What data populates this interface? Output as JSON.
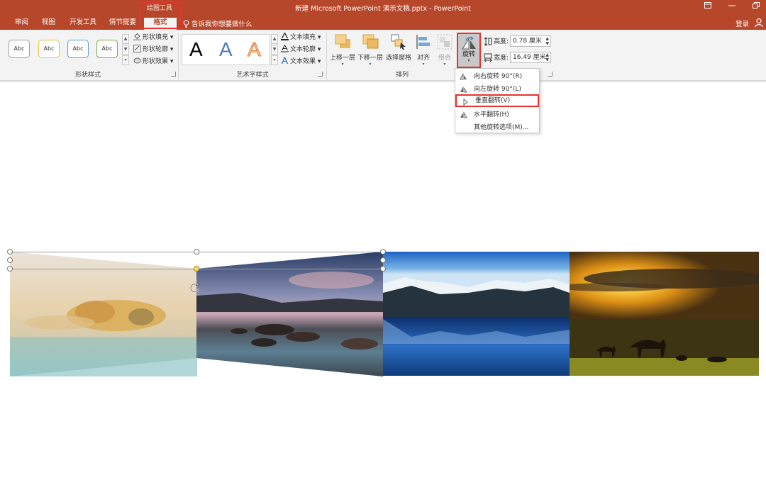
{
  "window": {
    "title": "新建 Microsoft PowerPoint 演示文稿.pptx - PowerPoint",
    "context_group": "绘图工具",
    "login": "登录"
  },
  "tabs": [
    "审阅",
    "视图",
    "开发工具",
    "情节提要",
    "格式"
  ],
  "tellme": "告诉我你想要做什么",
  "shape_styles": {
    "swatches": [
      "Abc",
      "Abc",
      "Abc",
      "Abc"
    ],
    "swatch_colors": [
      "#9e9e9e",
      "#e7c233",
      "#5b9bd5",
      "#70ad47"
    ],
    "fill": "形状填充",
    "outline": "形状轮廓",
    "effect": "形状效果",
    "group_label": "形状样式"
  },
  "wordart": {
    "letters": [
      "A",
      "A",
      "A"
    ],
    "text_fill": "文本填充",
    "text_outline": "文本轮廓",
    "text_effect": "文本效果",
    "group_label": "艺术字样式"
  },
  "arrange": {
    "bring_forward": "上移一层",
    "send_backward": "下移一层",
    "selection_pane": "选择窗格",
    "align": "对齐",
    "group": "组合",
    "rotate": "旋转",
    "group_label": "排列"
  },
  "size": {
    "height_label": "高度:",
    "height_value": "0.78 厘米",
    "width_label": "宽度:",
    "width_value": "16.49 厘米"
  },
  "rotate_menu": [
    "向右旋转 90°(R)",
    "向左旋转 90°(L)",
    "垂直翻转(V)",
    "水平翻转(H)",
    "其他旋转选项(M)..."
  ],
  "colors": {
    "accent": "#b7472a",
    "highlight": "#e8322e"
  }
}
